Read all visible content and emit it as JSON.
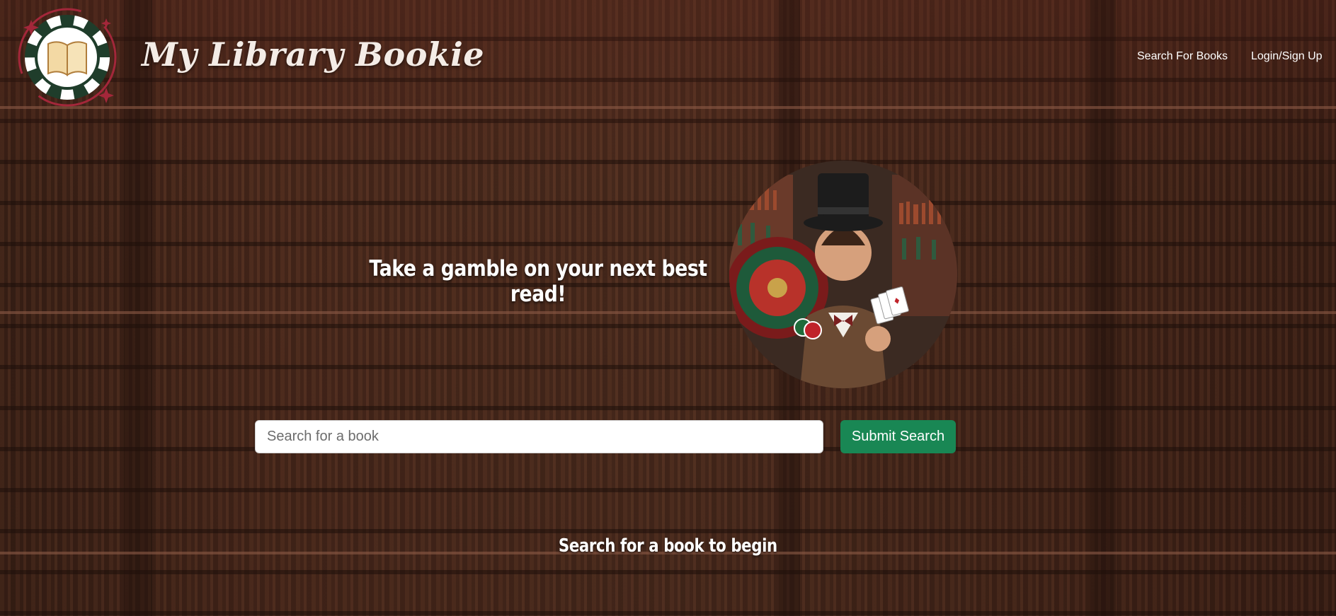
{
  "app": {
    "title": "My Library Bookie",
    "logo_icon": "book-poker-chip-logo"
  },
  "nav": {
    "search_label": "Search For Books",
    "login_label": "Login/Sign Up"
  },
  "hero": {
    "tagline": "Take a gamble on your next best read!",
    "image_icon": "gambler-portrait"
  },
  "search": {
    "placeholder": "Search for a book",
    "value": "",
    "submit_label": "Submit Search"
  },
  "status": {
    "message": "Search for a book to begin"
  },
  "colors": {
    "accent": "#198754",
    "logo_red": "#a3273a",
    "logo_green": "#1f3d2b",
    "text": "#ffffff"
  }
}
